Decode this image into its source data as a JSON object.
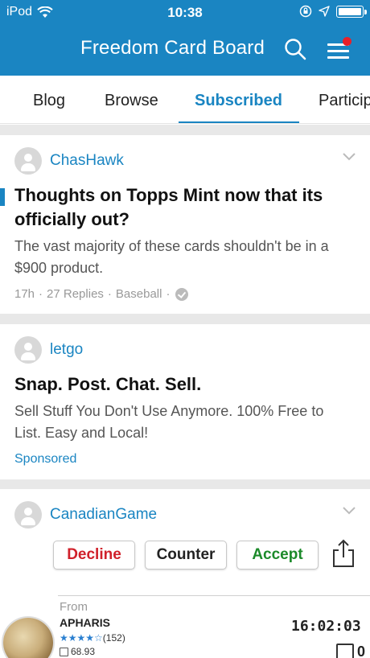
{
  "status_bar": {
    "carrier": "iPod",
    "time": "10:38"
  },
  "header": {
    "title": "Freedom Card Board",
    "background": "#1a85c2",
    "notification_color": "#e8202a"
  },
  "tabs": [
    {
      "label": "Blog",
      "active": false
    },
    {
      "label": "Browse",
      "active": false
    },
    {
      "label": "Subscribed",
      "active": true
    },
    {
      "label": "Particip",
      "active": false
    }
  ],
  "posts": [
    {
      "username": "ChasHawk",
      "title": "Thoughts on Topps Mint now that its officially out?",
      "body": "The vast majority of these cards shouldn't be in a $900 product.",
      "meta": {
        "age": "17h",
        "replies": "27 Replies",
        "category": "Baseball"
      }
    },
    {
      "username": "letgo",
      "title": "Snap. Post. Chat. Sell.",
      "body": "Sell Stuff You Don't Use Anymore. 100% Free to List. Easy and Local!",
      "sponsored_label": "Sponsored"
    },
    {
      "username": "CanadianGame",
      "trade_image": {
        "buttons": [
          {
            "label": "Decline",
            "color": "#d0202a"
          },
          {
            "label": "Counter",
            "color": "#222222"
          },
          {
            "label": "Accept",
            "color": "#1c8a2a"
          }
        ],
        "from_label": "From",
        "trader_name": "APHARIS",
        "stars": "★★★★☆",
        "star_count": "(152)",
        "rating_value": "68.93",
        "timer": "16:02:03",
        "counter_value": "0"
      }
    }
  ],
  "icons": [
    "wifi-icon",
    "lock-rotation-icon",
    "location-arrow-icon",
    "battery-icon",
    "search-icon",
    "menu-icon",
    "chevron-down-icon",
    "verified-check-icon",
    "share-icon",
    "avatar-icon"
  ]
}
